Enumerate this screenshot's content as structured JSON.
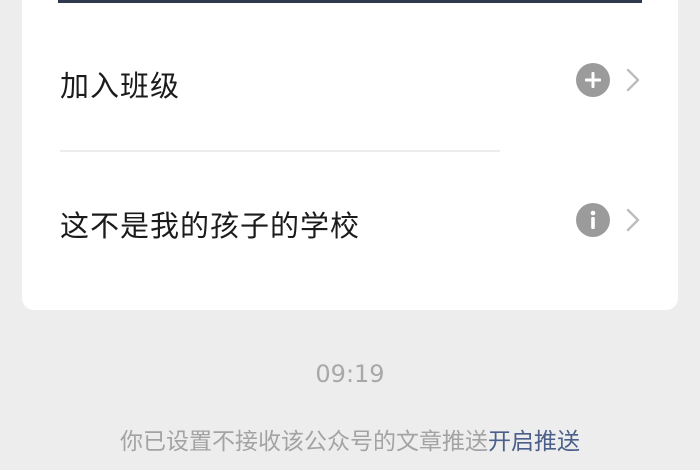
{
  "menu": {
    "items": [
      {
        "label": "加入班级",
        "icon": "plus-circle-icon"
      },
      {
        "label": "这不是我的孩子的学校",
        "icon": "info-circle-icon"
      }
    ]
  },
  "message": {
    "time": "09:19",
    "notice_text": "你已设置不接收该公众号的文章推送",
    "enable_link": "开启推送"
  },
  "colors": {
    "background": "#ededed",
    "card": "#ffffff",
    "link": "#4a5f8a",
    "icon_gray": "#9b9b9b"
  }
}
